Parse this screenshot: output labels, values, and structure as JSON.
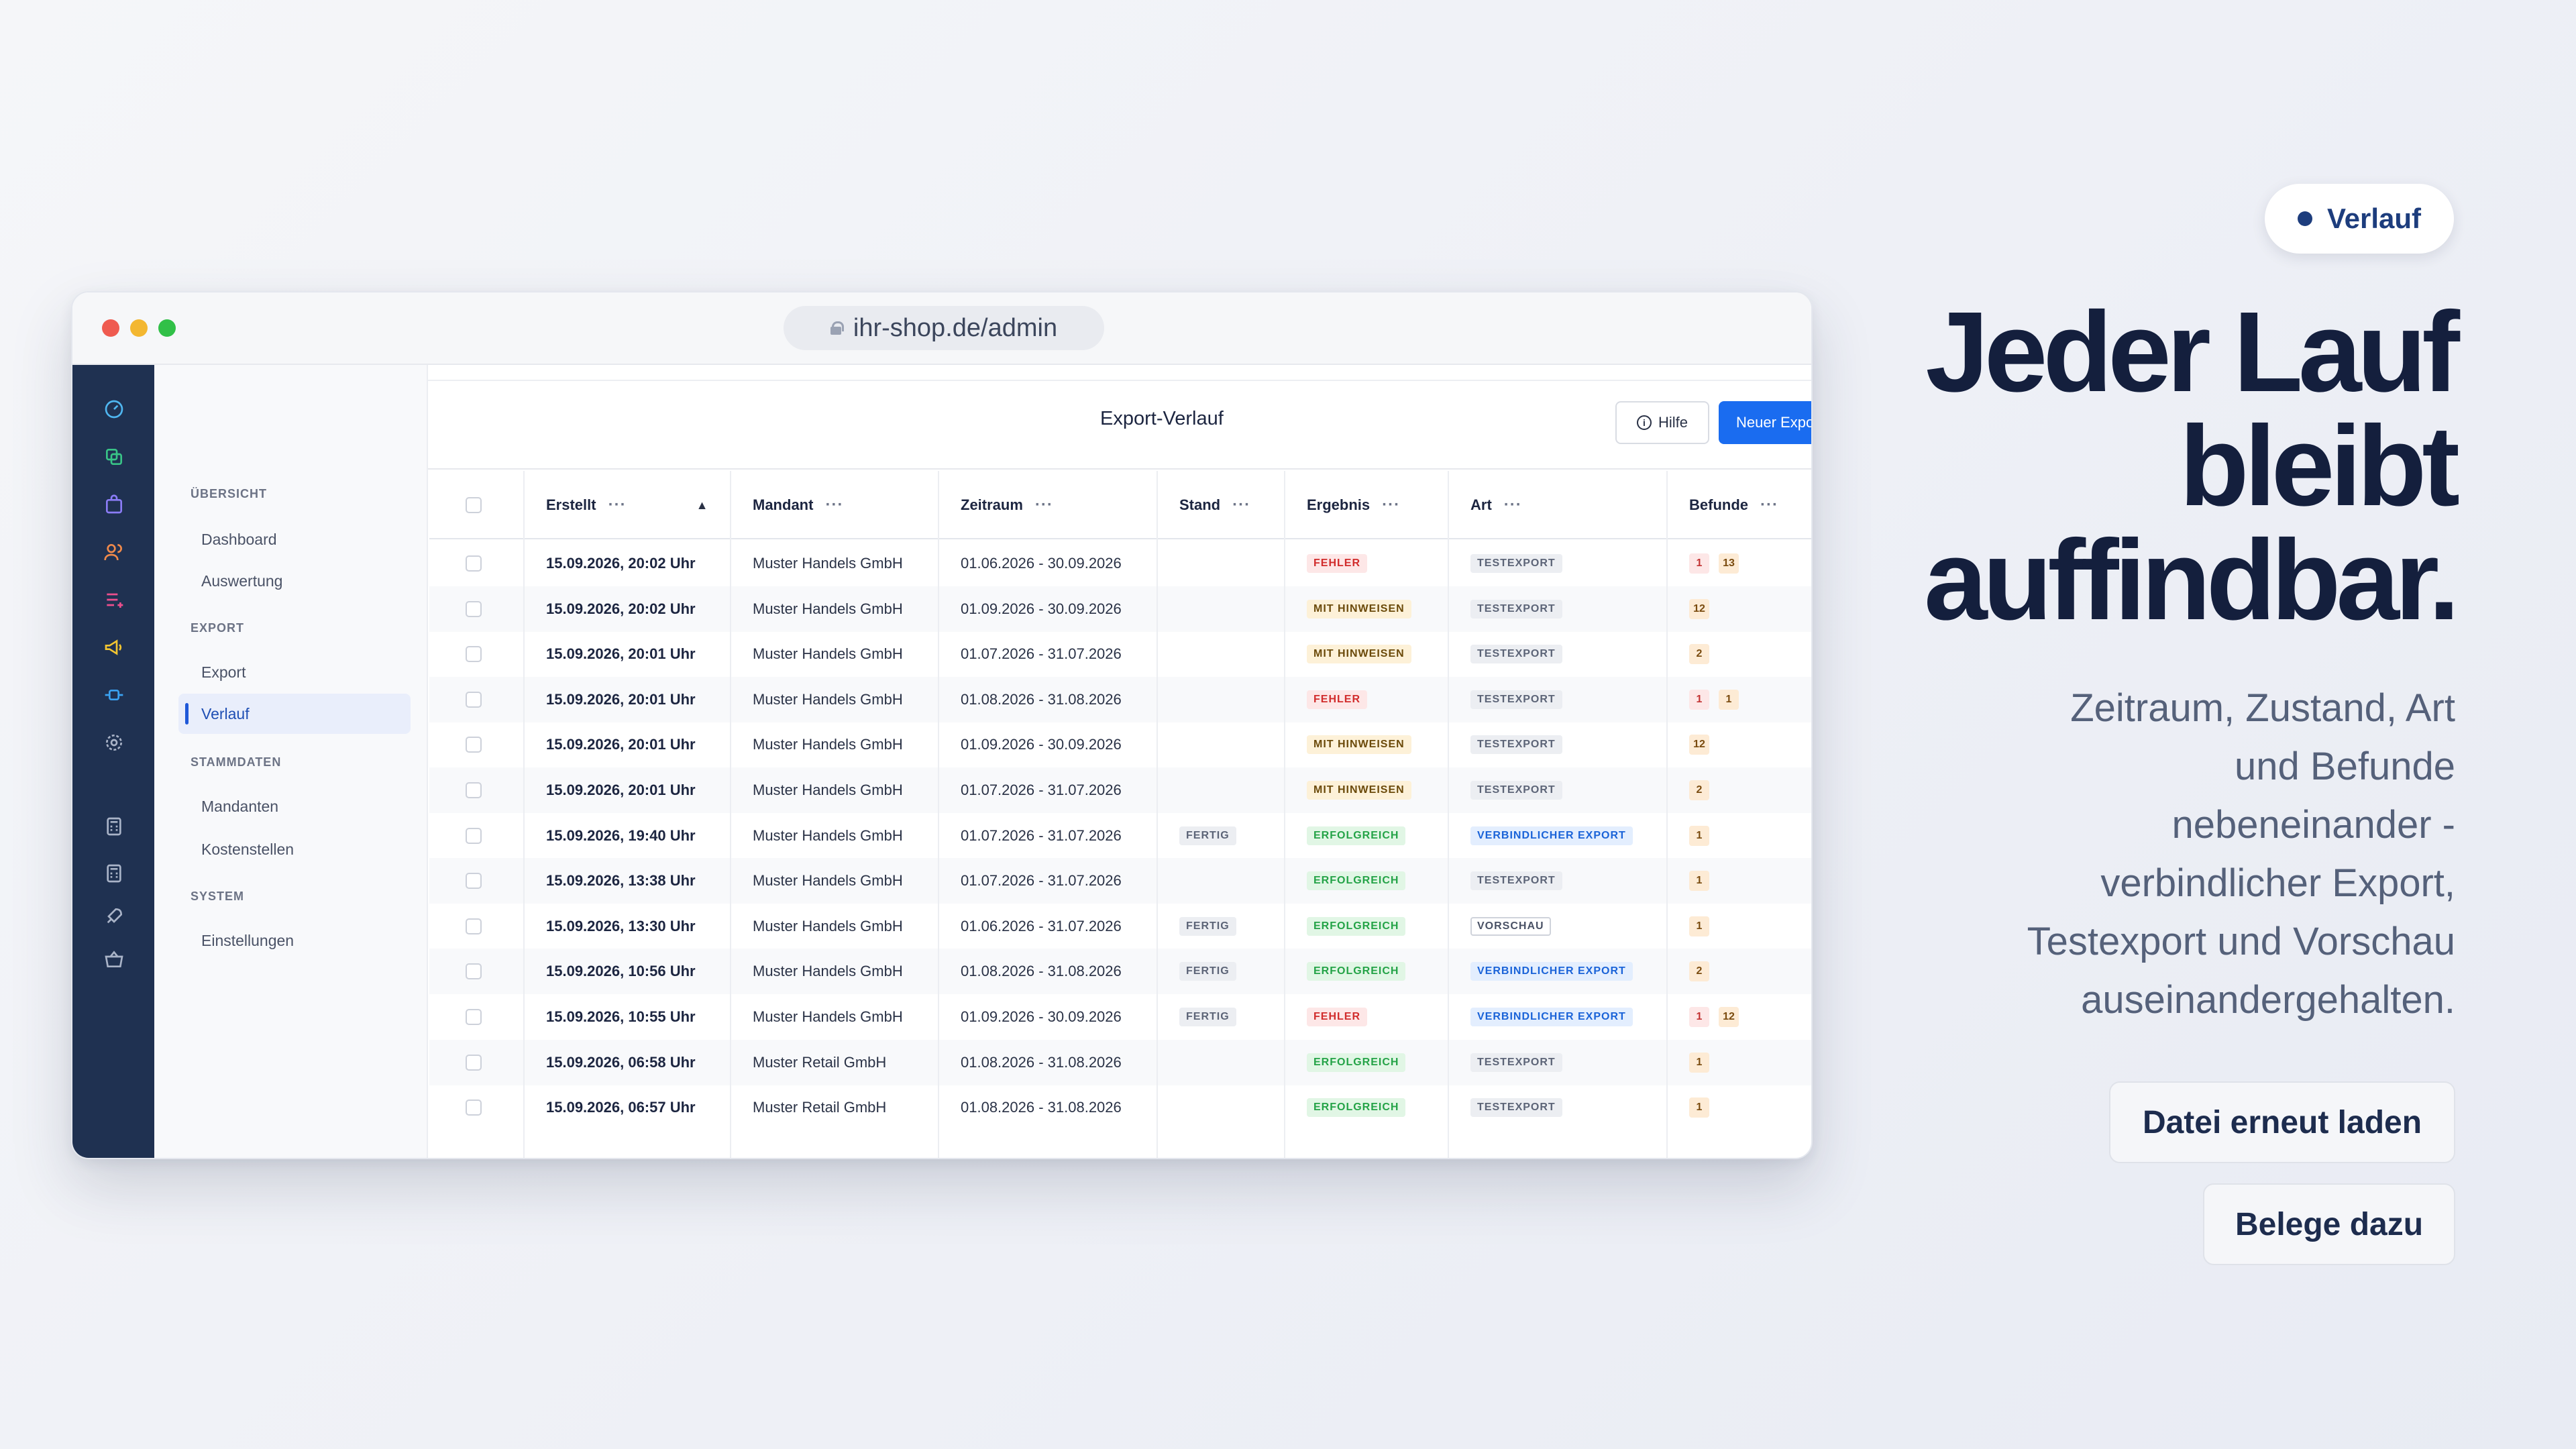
{
  "browser": {
    "url": "ihr-shop.de/admin"
  },
  "header": {
    "title": "Export-Verlauf",
    "help_label": "Hilfe",
    "new_label": "Neuer Export"
  },
  "sidebar": {
    "sections": [
      {
        "title": "ÜBERSICHT",
        "items": [
          {
            "label": "Dashboard"
          },
          {
            "label": "Auswertung"
          }
        ]
      },
      {
        "title": "EXPORT",
        "items": [
          {
            "label": "Export"
          },
          {
            "label": "Verlauf",
            "active": true
          }
        ]
      },
      {
        "title": "STAMMDATEN",
        "items": [
          {
            "label": "Mandanten"
          },
          {
            "label": "Kostenstellen"
          }
        ]
      },
      {
        "title": "SYSTEM",
        "items": [
          {
            "label": "Einstellungen"
          }
        ]
      }
    ]
  },
  "rail_icons": [
    "gauge-icon",
    "copy-icon",
    "bag-icon",
    "users-icon",
    "list-icon",
    "megaphone-icon",
    "plug-icon",
    "gear-icon",
    "calculator-icon",
    "calculator-icon",
    "rocket-icon",
    "basket-icon"
  ],
  "table": {
    "columns": [
      "Erstellt",
      "Mandant",
      "Zeitraum",
      "Stand",
      "Ergebnis",
      "Art",
      "Befunde"
    ],
    "rows": [
      {
        "erstellt": "15.09.2026, 20:02 Uhr",
        "mandant": "Muster Handels GmbH",
        "zeitraum": "01.06.2026 - 30.09.2026",
        "stand": "",
        "ergebnis": "FEHLER",
        "art": "TESTEXPORT",
        "befunde": [
          {
            "v": "1",
            "c": "red"
          },
          {
            "v": "13",
            "c": "amb"
          }
        ]
      },
      {
        "erstellt": "15.09.2026, 20:02 Uhr",
        "mandant": "Muster Handels GmbH",
        "zeitraum": "01.09.2026 - 30.09.2026",
        "stand": "",
        "ergebnis": "MIT HINWEISEN",
        "art": "TESTEXPORT",
        "befunde": [
          {
            "v": "12",
            "c": "amb"
          }
        ]
      },
      {
        "erstellt": "15.09.2026, 20:01 Uhr",
        "mandant": "Muster Handels GmbH",
        "zeitraum": "01.07.2026 - 31.07.2026",
        "stand": "",
        "ergebnis": "MIT HINWEISEN",
        "art": "TESTEXPORT",
        "befunde": [
          {
            "v": "2",
            "c": "amb"
          }
        ]
      },
      {
        "erstellt": "15.09.2026, 20:01 Uhr",
        "mandant": "Muster Handels GmbH",
        "zeitraum": "01.08.2026 - 31.08.2026",
        "stand": "",
        "ergebnis": "FEHLER",
        "art": "TESTEXPORT",
        "befunde": [
          {
            "v": "1",
            "c": "red"
          },
          {
            "v": "1",
            "c": "amb"
          }
        ]
      },
      {
        "erstellt": "15.09.2026, 20:01 Uhr",
        "mandant": "Muster Handels GmbH",
        "zeitraum": "01.09.2026 - 30.09.2026",
        "stand": "",
        "ergebnis": "MIT HINWEISEN",
        "art": "TESTEXPORT",
        "befunde": [
          {
            "v": "12",
            "c": "amb"
          }
        ]
      },
      {
        "erstellt": "15.09.2026, 20:01 Uhr",
        "mandant": "Muster Handels GmbH",
        "zeitraum": "01.07.2026 - 31.07.2026",
        "stand": "",
        "ergebnis": "MIT HINWEISEN",
        "art": "TESTEXPORT",
        "befunde": [
          {
            "v": "2",
            "c": "amb"
          }
        ]
      },
      {
        "erstellt": "15.09.2026, 19:40 Uhr",
        "mandant": "Muster Handels GmbH",
        "zeitraum": "01.07.2026 - 31.07.2026",
        "stand": "FERTIG",
        "ergebnis": "ERFOLGREICH",
        "art": "VERBINDLICHER EXPORT",
        "befunde": [
          {
            "v": "1",
            "c": "amb"
          }
        ]
      },
      {
        "erstellt": "15.09.2026, 13:38 Uhr",
        "mandant": "Muster Handels GmbH",
        "zeitraum": "01.07.2026 - 31.07.2026",
        "stand": "",
        "ergebnis": "ERFOLGREICH",
        "art": "TESTEXPORT",
        "befunde": [
          {
            "v": "1",
            "c": "amb"
          }
        ]
      },
      {
        "erstellt": "15.09.2026, 13:30 Uhr",
        "mandant": "Muster Handels GmbH",
        "zeitraum": "01.06.2026 - 31.07.2026",
        "stand": "FERTIG",
        "ergebnis": "ERFOLGREICH",
        "art": "VORSCHAU",
        "befunde": [
          {
            "v": "1",
            "c": "amb"
          }
        ]
      },
      {
        "erstellt": "15.09.2026, 10:56 Uhr",
        "mandant": "Muster Handels GmbH",
        "zeitraum": "01.08.2026 - 31.08.2026",
        "stand": "FERTIG",
        "ergebnis": "ERFOLGREICH",
        "art": "VERBINDLICHER EXPORT",
        "befunde": [
          {
            "v": "2",
            "c": "amb"
          }
        ]
      },
      {
        "erstellt": "15.09.2026, 10:55 Uhr",
        "mandant": "Muster Handels GmbH",
        "zeitraum": "01.09.2026 - 30.09.2026",
        "stand": "FERTIG",
        "ergebnis": "FEHLER",
        "art": "VERBINDLICHER EXPORT",
        "befunde": [
          {
            "v": "1",
            "c": "red"
          },
          {
            "v": "12",
            "c": "amb"
          }
        ]
      },
      {
        "erstellt": "15.09.2026, 06:58 Uhr",
        "mandant": "Muster Retail GmbH",
        "zeitraum": "01.08.2026 - 31.08.2026",
        "stand": "",
        "ergebnis": "ERFOLGREICH",
        "art": "TESTEXPORT",
        "befunde": [
          {
            "v": "1",
            "c": "amb"
          }
        ]
      },
      {
        "erstellt": "15.09.2026, 06:57 Uhr",
        "mandant": "Muster Retail GmbH",
        "zeitraum": "01.08.2026 - 31.08.2026",
        "stand": "",
        "ergebnis": "ERFOLGREICH",
        "art": "TESTEXPORT",
        "befunde": [
          {
            "v": "1",
            "c": "amb"
          }
        ]
      }
    ]
  },
  "hero": {
    "pill_label": "Verlauf",
    "headline_lines": [
      "Jeder Lauf",
      "bleibt",
      "auffindbar."
    ],
    "sub_lines": [
      "Zeitraum, Zustand, Art",
      "und Befunde",
      "nebeneinander -",
      "verbindlicher Export,",
      "Testexport und Vorschau",
      "auseinandergehalten."
    ],
    "cta_primary": "Datei erneut laden",
    "cta_secondary": "Belege dazu"
  },
  "colors": {
    "rail": "#1f3151",
    "accent": "#1a6cf0",
    "headline": "#141f3d"
  }
}
